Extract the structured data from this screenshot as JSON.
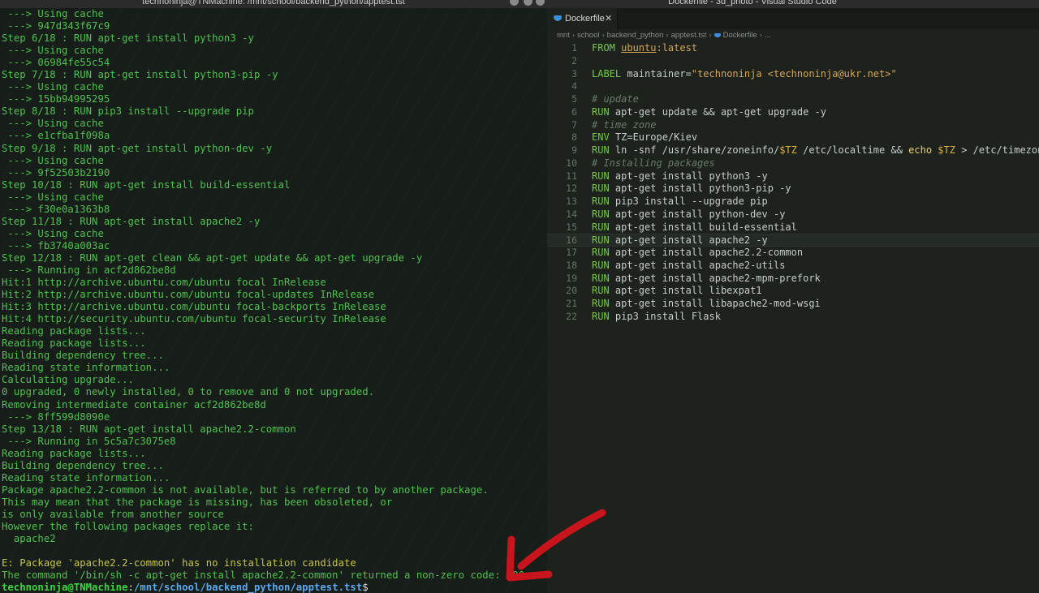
{
  "terminal": {
    "title": "technoninja@TNMachine: /mnt/school/backend_python/apptest.tst",
    "lines": [
      " ---> Using cache",
      " ---> 947d343f67c9",
      "Step 6/18 : RUN apt-get install python3 -y",
      " ---> Using cache",
      " ---> 06984fe55c54",
      "Step 7/18 : RUN apt-get install python3-pip -y",
      " ---> Using cache",
      " ---> 15bb94995295",
      "Step 8/18 : RUN pip3 install --upgrade pip",
      " ---> Using cache",
      " ---> e1cfba1f098a",
      "Step 9/18 : RUN apt-get install python-dev -y",
      " ---> Using cache",
      " ---> 9f52503b2190",
      "Step 10/18 : RUN apt-get install build-essential",
      " ---> Using cache",
      " ---> f30e0a1363b8",
      "Step 11/18 : RUN apt-get install apache2 -y",
      " ---> Using cache",
      " ---> fb3740a003ac",
      "Step 12/18 : RUN apt-get clean && apt-get update && apt-get upgrade -y",
      " ---> Running in acf2d862be8d",
      "Hit:1 http://archive.ubuntu.com/ubuntu focal InRelease",
      "Hit:2 http://archive.ubuntu.com/ubuntu focal-updates InRelease",
      "Hit:3 http://archive.ubuntu.com/ubuntu focal-backports InRelease",
      "Hit:4 http://security.ubuntu.com/ubuntu focal-security InRelease",
      "Reading package lists...",
      "Reading package lists...",
      "Building dependency tree...",
      "Reading state information...",
      "Calculating upgrade...",
      "0 upgraded, 0 newly installed, 0 to remove and 0 not upgraded.",
      "Removing intermediate container acf2d862be8d",
      " ---> 8ff599d8090e",
      "Step 13/18 : RUN apt-get install apache2.2-common",
      " ---> Running in 5c5a7c3075e8",
      "Reading package lists...",
      "Building dependency tree...",
      "Reading state information...",
      "Package apache2.2-common is not available, but is referred to by another package.",
      "This may mean that the package is missing, has been obsoleted, or",
      "is only available from another source",
      "However the following packages replace it:",
      "  apache2",
      "",
      "E: Package 'apache2.2-common' has no installation candidate",
      "The command '/bin/sh -c apt-get install apache2.2-common' returned a non-zero code: 100"
    ],
    "error_line_index": 45,
    "prompt": {
      "user_host": "technoninja@TNMachine",
      "sep": ":",
      "path": "/mnt/school/backend_python/apptest.tst",
      "symbol": "$"
    }
  },
  "vscode": {
    "title": "Dockerfile - 3d_photo - Visual Studio Code",
    "tab": {
      "label": "Dockerfile",
      "close": "✕"
    },
    "breadcrumbs": [
      "mnt",
      "school",
      "backend_python",
      "apptest.tst",
      "Dockerfile",
      "..."
    ],
    "active_line": 16,
    "code": [
      [
        [
          "kw",
          "FROM "
        ],
        [
          "ul",
          "ubuntu"
        ],
        [
          "str",
          ":latest"
        ]
      ],
      [],
      [
        [
          "kw",
          "LABEL "
        ],
        [
          "vr",
          "maintainer="
        ],
        [
          "str",
          "\"technoninja <technoninja@ukr.net>\""
        ]
      ],
      [],
      [
        [
          "cm",
          "# update"
        ]
      ],
      [
        [
          "kw",
          "RUN "
        ],
        [
          "vr",
          "apt-get update && apt-get upgrade -y"
        ]
      ],
      [
        [
          "cm",
          "# time zone"
        ]
      ],
      [
        [
          "kw",
          "ENV "
        ],
        [
          "vr",
          "TZ=Europe/Kiev"
        ]
      ],
      [
        [
          "kw",
          "RUN "
        ],
        [
          "vr",
          "ln -snf /usr/share/zoneinfo/"
        ],
        [
          "var",
          "$TZ"
        ],
        [
          "vr",
          " /etc/localtime && "
        ],
        [
          "ech",
          "echo "
        ],
        [
          "var",
          "$TZ"
        ],
        [
          "vr",
          " > /etc/timezone"
        ]
      ],
      [
        [
          "cm",
          "# Installing packages"
        ]
      ],
      [
        [
          "kw",
          "RUN "
        ],
        [
          "vr",
          "apt-get install python3 -y"
        ]
      ],
      [
        [
          "kw",
          "RUN "
        ],
        [
          "vr",
          "apt-get install python3-pip -y"
        ]
      ],
      [
        [
          "kw",
          "RUN "
        ],
        [
          "vr",
          "pip3 install --upgrade pip"
        ]
      ],
      [
        [
          "kw",
          "RUN "
        ],
        [
          "vr",
          "apt-get install python-dev -y"
        ]
      ],
      [
        [
          "kw",
          "RUN "
        ],
        [
          "vr",
          "apt-get install build-essential"
        ]
      ],
      [
        [
          "kw",
          "RUN "
        ],
        [
          "vr",
          "apt-get install apache2 -y"
        ]
      ],
      [
        [
          "kw",
          "RUN "
        ],
        [
          "vr",
          "apt-get install apache2.2-common"
        ]
      ],
      [
        [
          "kw",
          "RUN "
        ],
        [
          "vr",
          "apt-get install apache2-utils"
        ]
      ],
      [
        [
          "kw",
          "RUN "
        ],
        [
          "vr",
          "apt-get install apache2-mpm-prefork"
        ]
      ],
      [
        [
          "kw",
          "RUN "
        ],
        [
          "vr",
          "apt-get install libexpat1"
        ]
      ],
      [
        [
          "kw",
          "RUN "
        ],
        [
          "vr",
          "apt-get install libapache2-mod-wsgi"
        ]
      ],
      [
        [
          "kw",
          "RUN "
        ],
        [
          "vr",
          "pip3 install Flask"
        ]
      ]
    ]
  },
  "colors": {
    "terminal_text": "#4ec24e",
    "error_text": "#c5c34c",
    "annotation_arrow": "#c8141c",
    "keyword": "#78c848",
    "string": "#d6a55a"
  }
}
